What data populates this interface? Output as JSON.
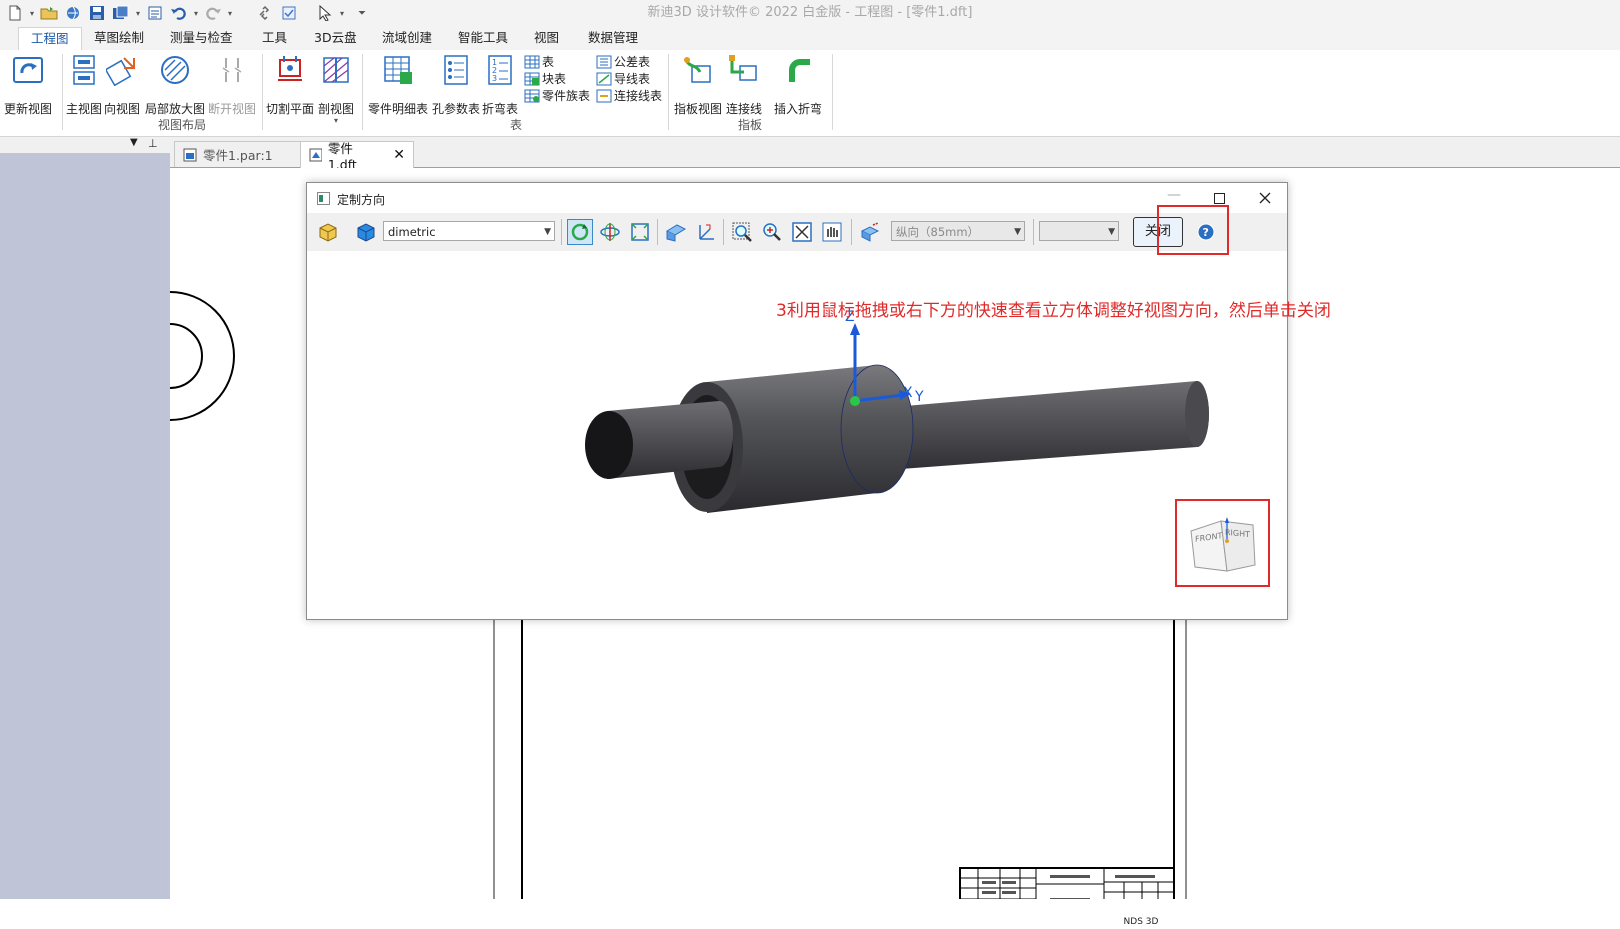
{
  "app": {
    "title": "新迪3D 设计软件© 2022 白金版 - 工程图 - [零件1.dft]"
  },
  "ribbon_tabs": [
    "工程图",
    "草图绘制",
    "测量与检查",
    "工具",
    "3D云盘",
    "流域创建",
    "智能工具",
    "视图",
    "数据管理"
  ],
  "ribbon": {
    "update_view": "更新视图",
    "main_view": "主视图",
    "direction_view": "向视图",
    "detail_view": "局部放大图",
    "break_view": "断开视图",
    "cutting_plane": "切割平面",
    "section_view": "剖视图",
    "group_view_layout": "视图布局",
    "parts_list": "零件明细表",
    "hole_table": "孔参数表",
    "bend_table": "折弯表",
    "table": "表",
    "block_table": "块表",
    "family_table": "零件族表",
    "tolerance_table": "公差表",
    "wire_table": "导线表",
    "connection_table": "连接线表",
    "group_table": "表",
    "harness_view": "指板视图",
    "connect_line": "连接线",
    "insert_bend": "插入折弯",
    "group_harness": "指板"
  },
  "doc_tabs": [
    {
      "label": "零件1.par:1"
    },
    {
      "label": "零件1.dft"
    }
  ],
  "dialog": {
    "title": "定制方向",
    "view_combo": "dimetric",
    "orientation_combo": "纵向（85mm）",
    "close_button": "关闭",
    "axis_z": "Z",
    "axis_x": "X",
    "axis_y": "Y",
    "cube_face_front": "FRONT",
    "cube_face_right": "RIGHT"
  },
  "annotation": {
    "text": "3利用鼠标拖拽或右下方的快速查看立方体调整好视图方向，然后单击关闭",
    "color": "#e02a2a"
  },
  "title_block": {
    "label": "NDS 3D"
  }
}
